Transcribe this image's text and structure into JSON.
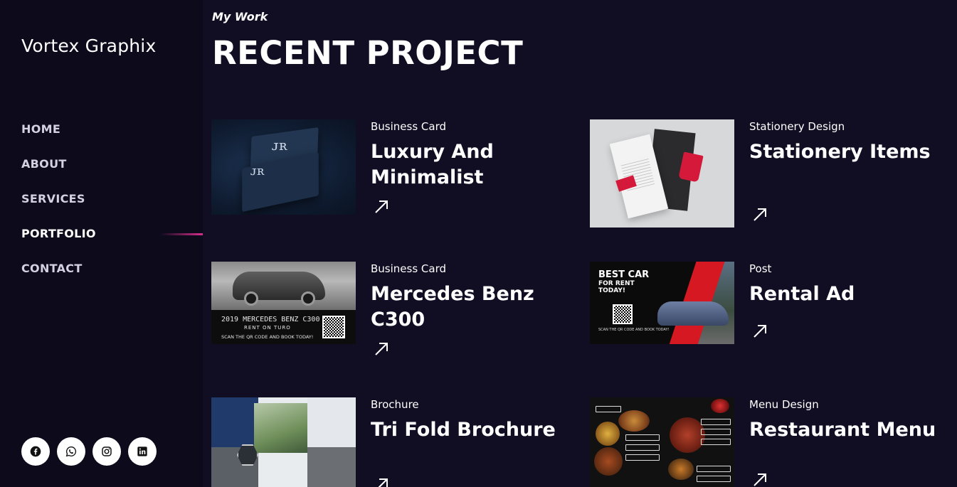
{
  "sidebar": {
    "brand": "Vortex Graphix",
    "nav": [
      {
        "label": "HOME",
        "active": false
      },
      {
        "label": "ABOUT",
        "active": false
      },
      {
        "label": "SERVICES",
        "active": false
      },
      {
        "label": "PORTFOLIO",
        "active": true
      },
      {
        "label": "CONTACT",
        "active": false
      }
    ],
    "socials": [
      "facebook-icon",
      "whatsapp-icon",
      "instagram-icon",
      "linkedin-icon"
    ]
  },
  "main": {
    "eyebrow": "My Work",
    "title": "RECENT PROJECT",
    "projects": [
      {
        "category": "Business Card",
        "title": "Luxury And Minimalist"
      },
      {
        "category": "Stationery Design",
        "title": "Stationery Items"
      },
      {
        "category": "Business Card",
        "title": "Mercedes Benz C300"
      },
      {
        "category": "Post",
        "title": "Rental Ad"
      },
      {
        "category": "Brochure",
        "title": "Tri Fold Brochure"
      },
      {
        "category": "Menu Design",
        "title": "Restaurant Menu"
      }
    ],
    "thumbs": {
      "merc_line1": "2019 MERCEDES BENZ C300",
      "merc_line2": "RENT ON TURO",
      "merc_line3": "SCAN THE QR CODE AND BOOK TODAY!",
      "rental_line1": "BEST CAR",
      "rental_line2": "FOR RENT TODAY!",
      "rental_line3": "SCAN THE QR CODE AND BOOK TODAY!"
    }
  },
  "colors": {
    "background": "#110d23",
    "sidebar": "#0c0a1b",
    "accent": "#d62e8c"
  }
}
